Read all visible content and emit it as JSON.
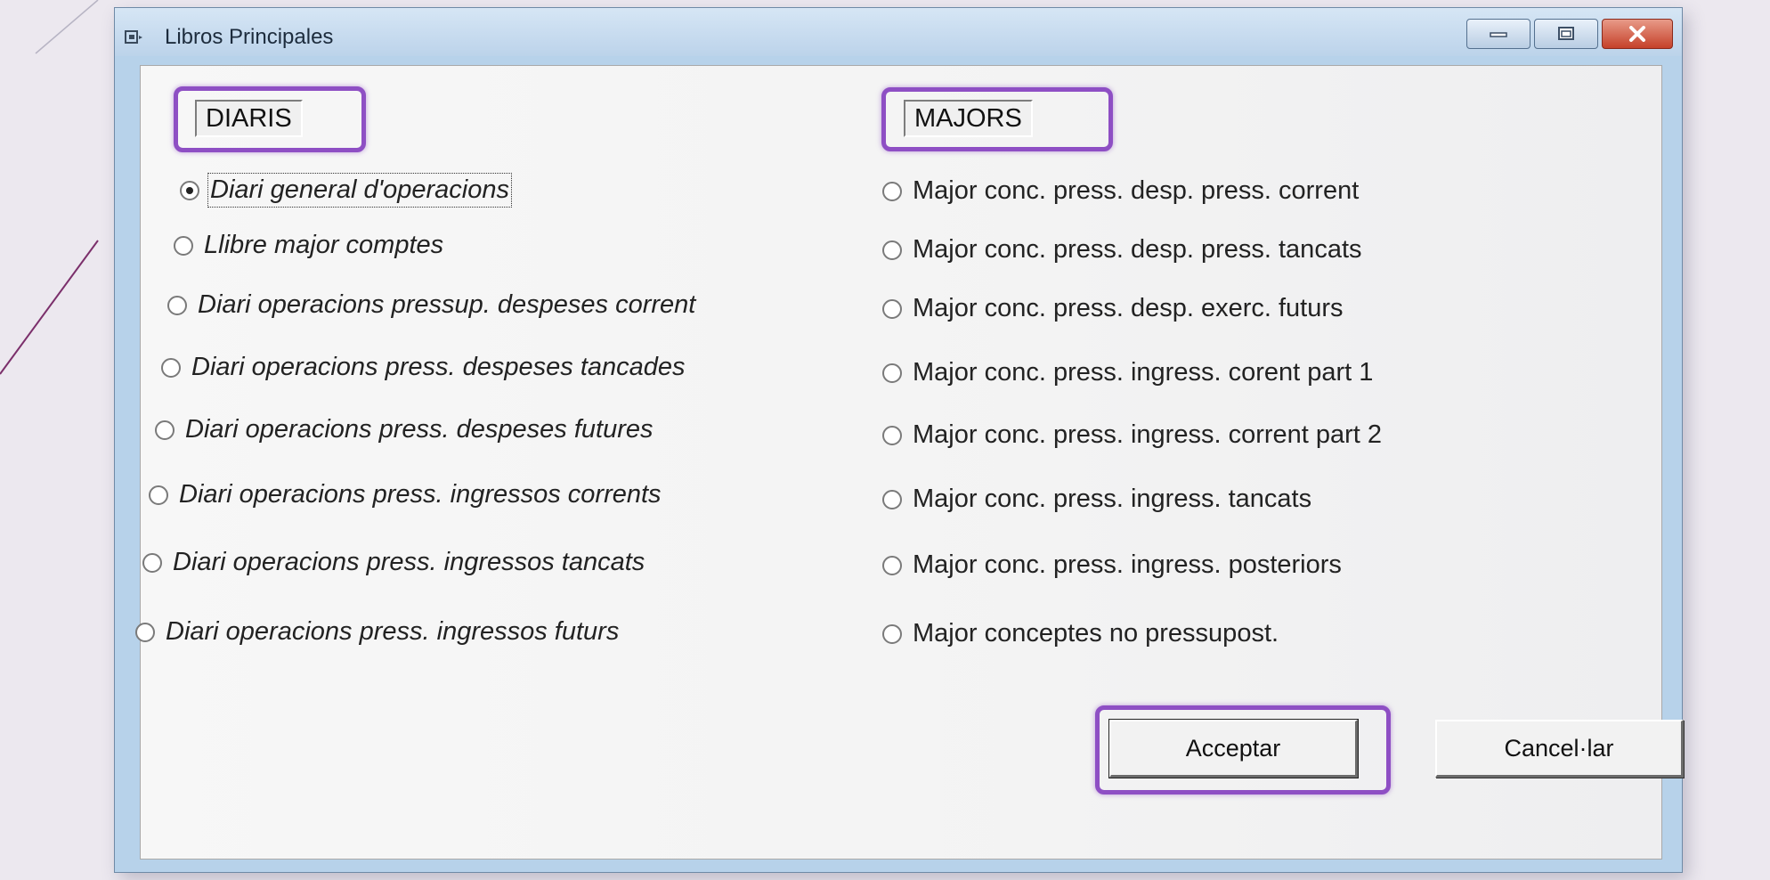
{
  "window": {
    "title": "Libros Principales",
    "icons": {
      "app": "app-icon",
      "minimize": "minimize-icon",
      "maximize": "maximize-icon",
      "close": "close-icon"
    }
  },
  "diaris": {
    "label": "DIARIS",
    "options": [
      {
        "label": "Diari general d'operacions",
        "checked": true
      },
      {
        "label": "Llibre major comptes",
        "checked": false
      },
      {
        "label": "Diari operacions pressup. despeses corrent",
        "checked": false
      },
      {
        "label": "Diari operacions press. despeses tancades",
        "checked": false
      },
      {
        "label": "Diari operacions press. despeses futures",
        "checked": false
      },
      {
        "label": "Diari operacions press. ingressos corrents",
        "checked": false
      },
      {
        "label": "Diari operacions press. ingressos tancats",
        "checked": false
      },
      {
        "label": "Diari operacions press. ingressos futurs",
        "checked": false
      }
    ]
  },
  "majors": {
    "label": "MAJORS",
    "options": [
      {
        "label": "Major conc. press. desp. press. corrent",
        "checked": false
      },
      {
        "label": "Major conc. press. desp. press. tancats",
        "checked": false
      },
      {
        "label": "Major conc. press. desp. exerc. futurs",
        "checked": false
      },
      {
        "label": "Major conc. press. ingress. corent part 1",
        "checked": false
      },
      {
        "label": "Major conc. press. ingress. corrent part 2",
        "checked": false
      },
      {
        "label": "Major conc. press. ingress. tancats",
        "checked": false
      },
      {
        "label": "Major conc. press. ingress. posteriors",
        "checked": false
      },
      {
        "label": "Major conceptes no pressupost.",
        "checked": false
      }
    ]
  },
  "buttons": {
    "accept": "Acceptar",
    "cancel": "Cancel·lar"
  },
  "colors": {
    "highlight": "#8e4fc4",
    "titlebar": "#bcd3ea",
    "close": "#c5412a"
  }
}
